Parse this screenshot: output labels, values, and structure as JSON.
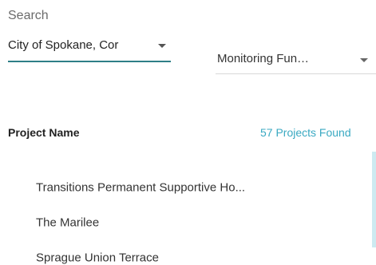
{
  "search": {
    "label": "Search"
  },
  "filters": {
    "city": {
      "value": "City of Spokane, Cor"
    },
    "monitoring": {
      "value": "Monitoring Fun…"
    }
  },
  "results": {
    "column_header": "Project Name",
    "count_text": "57 Projects Found",
    "projects": [
      {
        "name": "Transitions Permanent Supportive Ho..."
      },
      {
        "name": "The Marilee"
      },
      {
        "name": "Sprague Union Terrace"
      }
    ]
  },
  "icons": {
    "dropdown_arrow": "chevron-down-icon"
  },
  "colors": {
    "accent": "#2f7f87",
    "count": "#3aa9c2"
  }
}
